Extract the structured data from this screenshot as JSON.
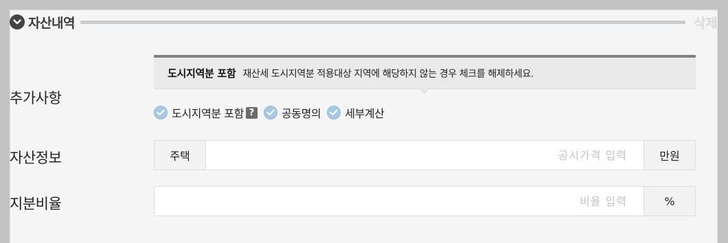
{
  "section": {
    "title": "자산내역",
    "delete_label": "삭제"
  },
  "additional": {
    "label": "추가사항",
    "tooltip_title": "도시지역분 포함",
    "tooltip_text": "재산세 도시지역분 적용대상 지역에 해당하지 않는 경우 체크를 해제하세요.",
    "options": [
      {
        "label": "도시지역분 포함",
        "checked": true,
        "has_help": true
      },
      {
        "label": "공동명의",
        "checked": true,
        "has_help": false
      },
      {
        "label": "세부계산",
        "checked": true,
        "has_help": false
      }
    ],
    "help_glyph": "?"
  },
  "asset_info": {
    "label": "자산정보",
    "prefix": "주택",
    "value": "",
    "placeholder": "공시가격 입력",
    "unit": "만원"
  },
  "share_ratio": {
    "label": "지분비율",
    "value": "",
    "placeholder": "비율 입력",
    "unit": "%"
  },
  "colors": {
    "check_fill": "#a8c9e3",
    "header_line": "#c9cdcf",
    "delete_text": "#d8dadc",
    "tooltip_border": "#808080"
  }
}
